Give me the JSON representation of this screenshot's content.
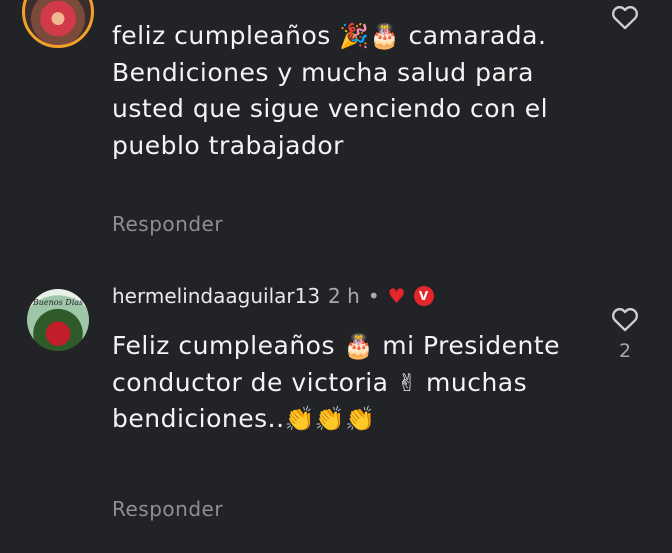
{
  "comments": [
    {
      "username": "",
      "text_line_1_prefix": "feliz cumpleaños",
      "text_line_1_emojis": "🎉🎂",
      "text_rest": "camarada. Bendiciones y mucha salud para usted que sigue venciendo con el pueblo trabajador",
      "reply_label": "Responder",
      "like_icon": "heart-outline-icon",
      "like_count": ""
    },
    {
      "username": "hermelindaaguilar13",
      "time": "2 h",
      "separator": "•",
      "liked_by_author_icon": "heart-filled-icon",
      "author_badge_letter": "V",
      "text_segment_1": "Feliz cumpleaños",
      "text_emoji_1": "🎂",
      "text_segment_2": "mi Presidente conductor de victoria",
      "text_emoji_2": "✌",
      "text_segment_3": "muchas bendiciones..",
      "text_emoji_3": "👏👏👏",
      "avatar_text": "Buenos Días",
      "reply_label": "Responder",
      "like_icon": "heart-outline-icon",
      "like_count": "2"
    }
  ],
  "colors": {
    "background": "#222327",
    "text": "#f4f4f4",
    "muted": "#8e8f93",
    "liked_heart": "#e5252c"
  }
}
